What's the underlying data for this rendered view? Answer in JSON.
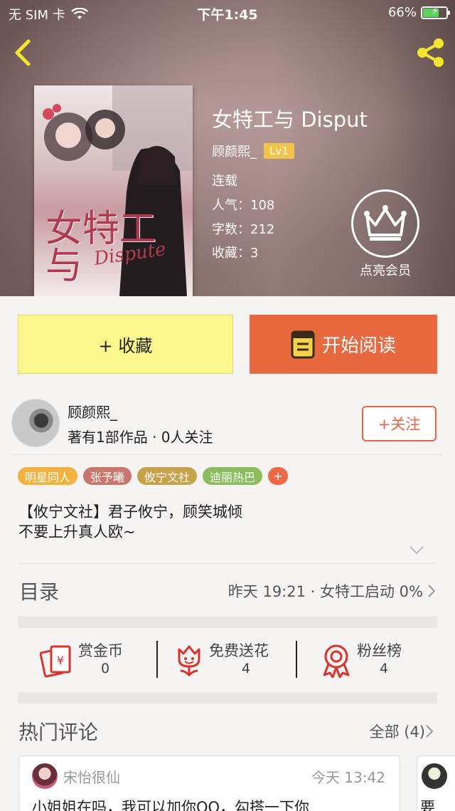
{
  "status_bar": {
    "carrier": "无 SIM 卡",
    "time": "下午1:45",
    "battery": "66%"
  },
  "book": {
    "title": "女特工与 Disput",
    "author": "顾颜熙_",
    "level": "Lv1",
    "status": "连载",
    "popularity": "人气：108",
    "words": "字数：212",
    "favorites": "收藏：3",
    "cover_title": "女特工\n与",
    "cover_subtitle": "Dispute"
  },
  "vip": {
    "label": "点亮会员"
  },
  "actions": {
    "collect": "+ 收藏",
    "read": "开始阅读"
  },
  "author": {
    "name": "顾颜熙_",
    "stats": "著有1部作品 · 0人关注",
    "follow": "+关注"
  },
  "tags": [
    {
      "label": "明星同人",
      "color": "#f2b23e"
    },
    {
      "label": "张予曦",
      "color": "#c9776d"
    },
    {
      "label": "攸宁文社",
      "color": "#c8a24a"
    },
    {
      "label": "迪丽热巴",
      "color": "#8bbd5c"
    }
  ],
  "tag_add": "+",
  "intro": {
    "line1": "【攸宁文社】君子攸宁，顾笑城倾",
    "line2": "不要上升真人欧~"
  },
  "catalog": {
    "title": "目录",
    "info": "昨天 19:21 · 女特工启动 0%"
  },
  "stats": [
    {
      "label": "赏金币",
      "value": "0"
    },
    {
      "label": "免费送花",
      "value": "4"
    },
    {
      "label": "粉丝榜",
      "value": "4"
    }
  ],
  "hot_comments": {
    "title": "热门评论",
    "all": "全部 (4)",
    "items": [
      {
        "name": "宋怡很仙",
        "time": "今天 13:42",
        "text": "小姐姐在吗，我可以加你QQ，勾搭一下你"
      },
      {
        "text": "要"
      }
    ]
  },
  "colors": {
    "accent": "#e8683f",
    "collect_bg": "#fbf78c",
    "icon_red": "#d9342b",
    "share_yellow": "#f5e52c"
  }
}
